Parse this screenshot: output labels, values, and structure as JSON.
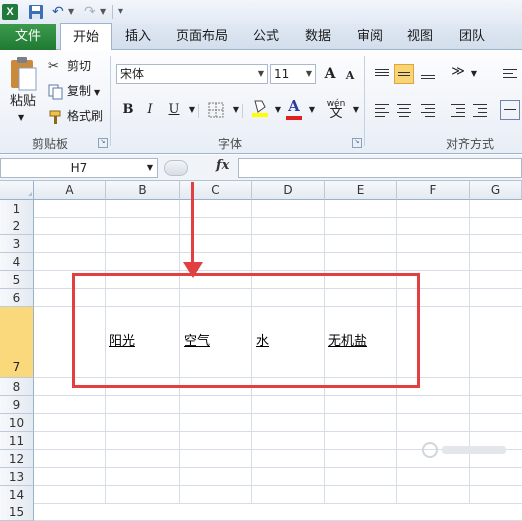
{
  "tabs": {
    "file": "文件",
    "home": "开始",
    "insert": "插入",
    "page_layout": "页面布局",
    "formulas": "公式",
    "data": "数据",
    "review": "审阅",
    "view": "视图",
    "team": "团队"
  },
  "clipboard": {
    "paste": "粘贴",
    "cut": "剪切",
    "copy": "复制",
    "format_painter": "格式刷",
    "group_label": "剪贴板"
  },
  "font": {
    "name": "宋体",
    "size": "11",
    "bold": "B",
    "italic": "I",
    "underline": "U",
    "grow": "A",
    "shrink": "A",
    "group_label": "字体",
    "phonetic": "wén"
  },
  "alignment": {
    "group_label": "对齐方式"
  },
  "formula_bar": {
    "name_box": "H7",
    "fx": "fx",
    "value": ""
  },
  "columns": [
    "A",
    "B",
    "C",
    "D",
    "E",
    "F",
    "G"
  ],
  "rows": [
    "1",
    "2",
    "3",
    "4",
    "5",
    "6",
    "7",
    "8",
    "9",
    "10",
    "11",
    "12",
    "13",
    "14",
    "15"
  ],
  "selected_row": "7",
  "cells": {
    "B7": "阳光",
    "C7": "空气",
    "D7": "水",
    "E7": "无机盐"
  },
  "colors": {
    "file_tab": "#2a8a3f",
    "annotation": "#e24040",
    "selected_row_header": "#f9d97c"
  }
}
